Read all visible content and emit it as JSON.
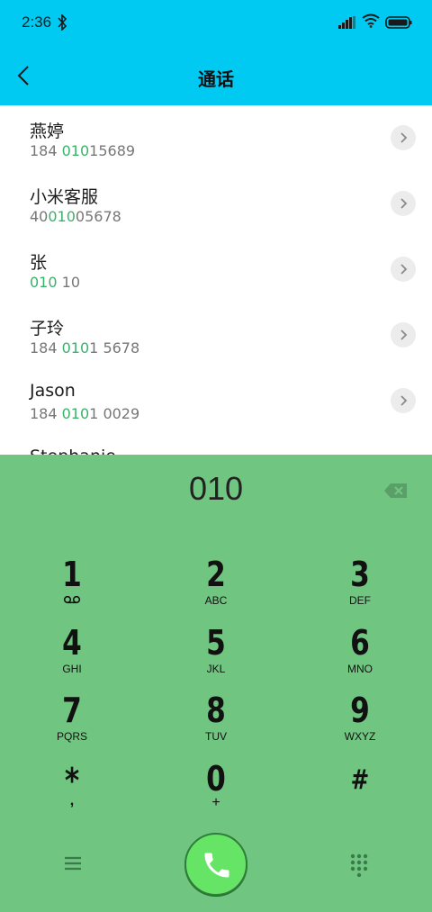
{
  "status": {
    "time": "2:36"
  },
  "header": {
    "title": "通话"
  },
  "contacts": [
    {
      "name": "燕婷",
      "num_pre": "184 ",
      "num_hl": "010",
      "num_post": "15689"
    },
    {
      "name": "小米客服",
      "num_pre": "40",
      "num_hl": "010",
      "num_post": "05678"
    },
    {
      "name": "张",
      "num_pre": "",
      "num_hl": "010",
      "num_post": " 10"
    },
    {
      "name": "子玲",
      "num_pre": "184 ",
      "num_hl": "010",
      "num_post": "1 5678"
    },
    {
      "name": "Jason",
      "num_pre": "184 ",
      "num_hl": "010",
      "num_post": "1 0029"
    },
    {
      "name": "Stephanie",
      "num_pre": "",
      "num_hl": "",
      "num_post": ""
    }
  ],
  "dialer": {
    "entered": "010",
    "keys": [
      {
        "digit": "1",
        "letters": ""
      },
      {
        "digit": "2",
        "letters": "ABC"
      },
      {
        "digit": "3",
        "letters": "DEF"
      },
      {
        "digit": "4",
        "letters": "GHI"
      },
      {
        "digit": "5",
        "letters": "JKL"
      },
      {
        "digit": "6",
        "letters": "MNO"
      },
      {
        "digit": "7",
        "letters": "PQRS"
      },
      {
        "digit": "8",
        "letters": "TUV"
      },
      {
        "digit": "9",
        "letters": "WXYZ"
      },
      {
        "digit": "*",
        "letters": ","
      },
      {
        "digit": "0",
        "letters": "+"
      },
      {
        "digit": "#",
        "letters": ""
      }
    ]
  },
  "colors": {
    "header": "#00c9f2",
    "dialpad": "#70c580",
    "highlight": "#39b36a",
    "call_button": "#66e466"
  },
  "icons": [
    "bluetooth-icon",
    "signal-icon",
    "wifi-icon",
    "battery-icon",
    "back-arrow-icon",
    "chevron-right-icon",
    "backspace-icon",
    "voicemail-icon",
    "menu-icon",
    "keypad-grid-icon",
    "phone-icon"
  ]
}
